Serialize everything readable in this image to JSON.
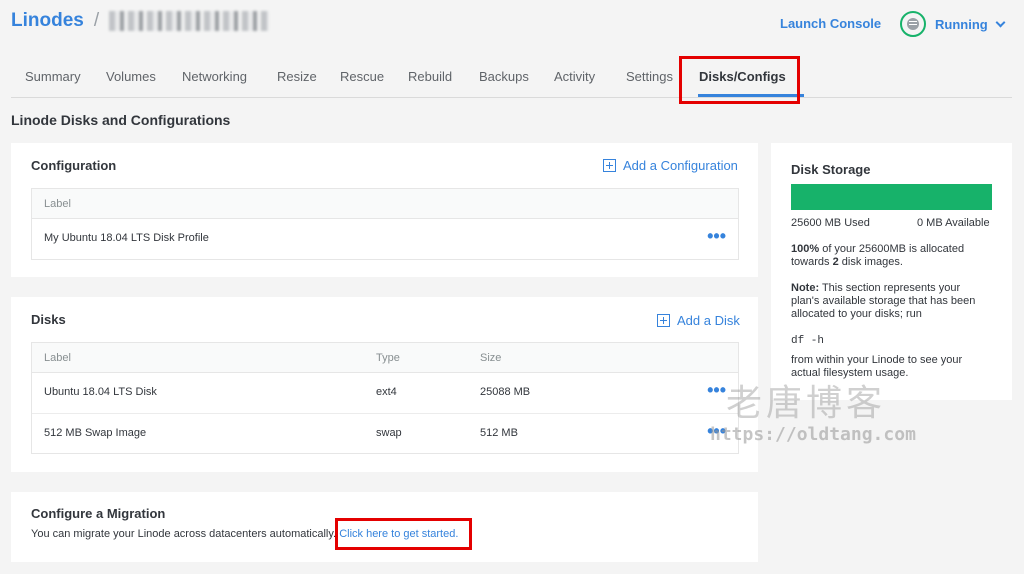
{
  "header": {
    "breadcrumb_root": "Linodes",
    "breadcrumb_sep": "/",
    "launch_console": "Launch Console",
    "status": "Running"
  },
  "tabs": [
    "Summary",
    "Volumes",
    "Networking",
    "Resize",
    "Rescue",
    "Rebuild",
    "Backups",
    "Activity",
    "Settings",
    "Disks/Configs"
  ],
  "active_tab": "Disks/Configs",
  "page_title": "Linode Disks and Configurations",
  "configuration": {
    "title": "Configuration",
    "add_label": "Add a Configuration",
    "columns": [
      "Label"
    ],
    "rows": [
      {
        "label": "My Ubuntu 18.04 LTS Disk Profile"
      }
    ]
  },
  "disks": {
    "title": "Disks",
    "add_label": "Add a Disk",
    "columns": [
      "Label",
      "Type",
      "Size"
    ],
    "rows": [
      {
        "label": "Ubuntu 18.04 LTS Disk",
        "type": "ext4",
        "size": "25088 MB"
      },
      {
        "label": "512 MB Swap Image",
        "type": "swap",
        "size": "512 MB"
      }
    ]
  },
  "migration": {
    "title": "Configure a Migration",
    "text": "You can migrate your Linode across datacenters automatically.",
    "link": "Click here to get started."
  },
  "storage": {
    "title": "Disk Storage",
    "used": "25600 MB Used",
    "available": "0 MB Available",
    "used_fraction": 1.0,
    "alloc_pct": "100%",
    "alloc_text_1": " of your 25600MB is allocated",
    "alloc_text_2a": "towards ",
    "alloc_count": "2",
    "alloc_text_2b": " disk images.",
    "note_label": "Note:",
    "note_text_1": " This section represents your",
    "note_text_2": "plan's available storage that has been",
    "note_text_3": "allocated to your disks; run",
    "command": "df -h",
    "after_1": "from within your Linode to see your",
    "after_2": "actual filesystem usage."
  },
  "watermark": {
    "cn": "老唐博客",
    "url": "https://oldtang.com"
  },
  "colors": {
    "accent": "#3683dc",
    "success": "#17b26a",
    "highlight": "#e40000"
  }
}
